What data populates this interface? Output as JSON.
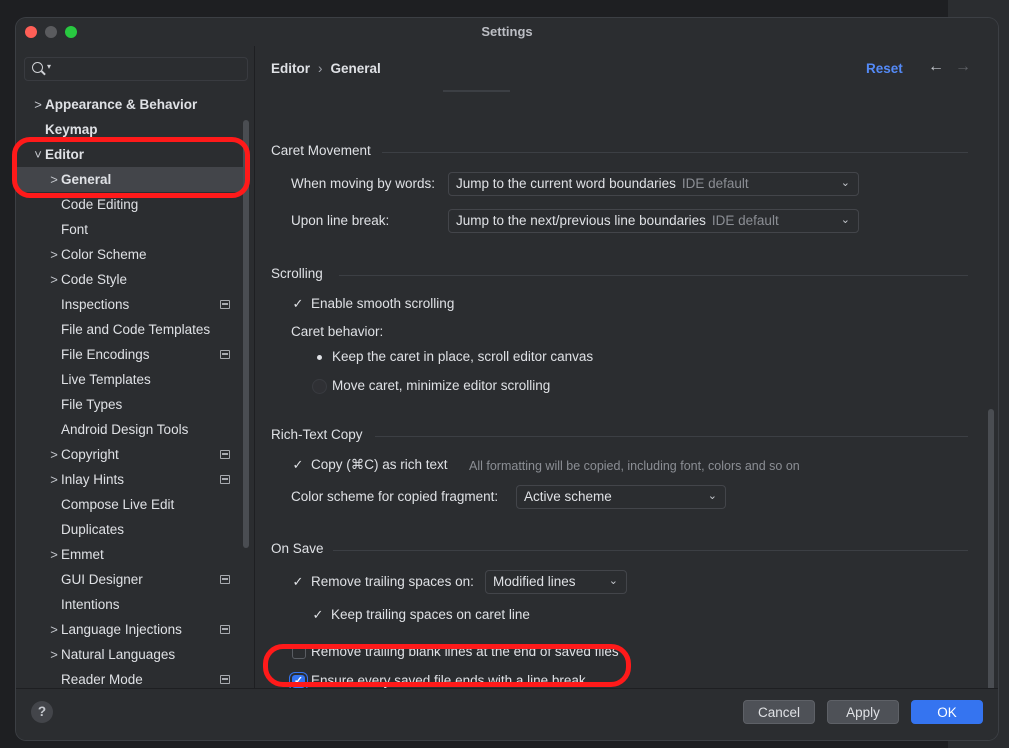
{
  "window": {
    "title": "Settings"
  },
  "search": {
    "placeholder": ""
  },
  "sidebar": {
    "items": [
      {
        "label": "Appearance & Behavior",
        "chevron": ">",
        "level": 0,
        "bold": true,
        "badge": false
      },
      {
        "label": "Keymap",
        "chevron": "",
        "level": 0,
        "bold": true,
        "badge": false
      },
      {
        "label": "Editor",
        "chevron": "˅",
        "level": 0,
        "bold": true,
        "badge": false
      },
      {
        "label": "General",
        "chevron": ">",
        "level": 1,
        "bold": true,
        "badge": false,
        "selected": true
      },
      {
        "label": "Code Editing",
        "chevron": "",
        "level": 1,
        "badge": false
      },
      {
        "label": "Font",
        "chevron": "",
        "level": 1,
        "badge": false
      },
      {
        "label": "Color Scheme",
        "chevron": ">",
        "level": 1,
        "badge": false
      },
      {
        "label": "Code Style",
        "chevron": ">",
        "level": 1,
        "badge": false
      },
      {
        "label": "Inspections",
        "chevron": "",
        "level": 1,
        "badge": true
      },
      {
        "label": "File and Code Templates",
        "chevron": "",
        "level": 1,
        "badge": false
      },
      {
        "label": "File Encodings",
        "chevron": "",
        "level": 1,
        "badge": true
      },
      {
        "label": "Live Templates",
        "chevron": "",
        "level": 1,
        "badge": false
      },
      {
        "label": "File Types",
        "chevron": "",
        "level": 1,
        "badge": false
      },
      {
        "label": "Android Design Tools",
        "chevron": "",
        "level": 1,
        "badge": false
      },
      {
        "label": "Copyright",
        "chevron": ">",
        "level": 1,
        "badge": true
      },
      {
        "label": "Inlay Hints",
        "chevron": ">",
        "level": 1,
        "badge": true
      },
      {
        "label": "Compose Live Edit",
        "chevron": "",
        "level": 1,
        "badge": false
      },
      {
        "label": "Duplicates",
        "chevron": "",
        "level": 1,
        "badge": false
      },
      {
        "label": "Emmet",
        "chevron": ">",
        "level": 1,
        "badge": false
      },
      {
        "label": "GUI Designer",
        "chevron": "",
        "level": 1,
        "badge": true
      },
      {
        "label": "Intentions",
        "chevron": "",
        "level": 1,
        "badge": false
      },
      {
        "label": "Language Injections",
        "chevron": ">",
        "level": 1,
        "badge": true
      },
      {
        "label": "Natural Languages",
        "chevron": ">",
        "level": 1,
        "badge": false
      },
      {
        "label": "Reader Mode",
        "chevron": "",
        "level": 1,
        "badge": true
      }
    ]
  },
  "header": {
    "breadcrumb_1": "Editor",
    "breadcrumb_sep": "›",
    "breadcrumb_2": "General",
    "reset": "Reset",
    "back_arrow": "←",
    "forward_arrow": "→"
  },
  "caret": {
    "title": "Caret Movement",
    "words_label": "When moving by words:",
    "words_value": "Jump to the current word boundaries",
    "words_default": "IDE default",
    "line_label": "Upon line break:",
    "line_value": "Jump to the next/previous line boundaries",
    "line_default": "IDE default"
  },
  "scrolling": {
    "title": "Scrolling",
    "smooth": "Enable smooth scrolling",
    "smooth_checked": true,
    "behavior_label": "Caret behavior:",
    "option_1": "Keep the caret in place, scroll editor canvas",
    "option_2": "Move caret, minimize editor scrolling",
    "selected_option": 1
  },
  "richtext": {
    "title": "Rich-Text Copy",
    "copy_label": "Copy (⌘C) as rich text",
    "copy_checked": true,
    "copy_hint": "All formatting will be copied, including font, colors and so on",
    "scheme_label": "Color scheme for copied fragment:",
    "scheme_value": "Active scheme"
  },
  "onsave": {
    "title": "On Save",
    "trailing_label": "Remove trailing spaces on:",
    "trailing_checked": true,
    "trailing_value": "Modified lines",
    "keep_label": "Keep trailing spaces on caret line",
    "keep_checked": true,
    "blank_label": "Remove trailing blank lines at the end of saved files",
    "blank_checked": false,
    "ensure_label": "Ensure every saved file ends with a line break",
    "ensure_checked": true
  },
  "footer": {
    "help": "?",
    "cancel": "Cancel",
    "apply": "Apply",
    "ok": "OK"
  },
  "icons": {
    "check": "✓",
    "dropdown": "⌄"
  },
  "colors": {
    "accent": "#3574f0",
    "link": "#548af7",
    "annotation": "#ff1a1a"
  }
}
